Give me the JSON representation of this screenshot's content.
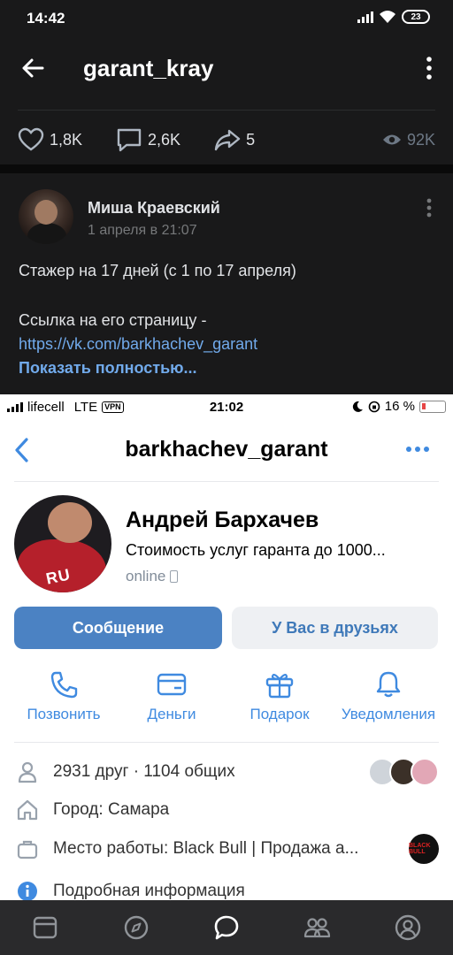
{
  "dark_screen": {
    "status_time": "14:42",
    "battery": "23",
    "header_title": "garant_kray",
    "stats": {
      "likes": "1,8K",
      "comments": "2,6K",
      "shares": "5",
      "views": "92K"
    },
    "post": {
      "author": "Миша Краевский",
      "date": "1 апреля в 21:07",
      "text_line1": "Стажер на 17 дней (с 1 по 17 апреля)",
      "text_line2": "Ссылка на его страницу -",
      "link": "https://vk.com/barkhachev_garant",
      "show_more": "Показать полностью..."
    }
  },
  "light_screen": {
    "status": {
      "carrier": "lifecell",
      "network": "LTE",
      "vpn": "VPN",
      "time": "21:02",
      "battery_text": "16 %"
    },
    "header_title": "barkhachev_garant",
    "profile": {
      "name": "Андрей Бархачев",
      "status": "Стоимость услуг гаранта до 1000...",
      "online": "online",
      "avatar_print": "RU"
    },
    "buttons": {
      "message": "Сообщение",
      "friends": "У Вас в друзьях"
    },
    "actions": [
      "Позвонить",
      "Деньги",
      "Подарок",
      "Уведомления"
    ],
    "info": {
      "friends": "2931 друг · 1104 общих",
      "city": "Город: Самара",
      "work": "Место работы: Black Bull | Продажа а...",
      "work_logo": "BLACK BULL",
      "more": "Подробная информация"
    }
  },
  "colors": {
    "vk_blue": "#4b82c3",
    "link_blue": "#71aaeb",
    "accent_blue": "#3f8ae0"
  }
}
